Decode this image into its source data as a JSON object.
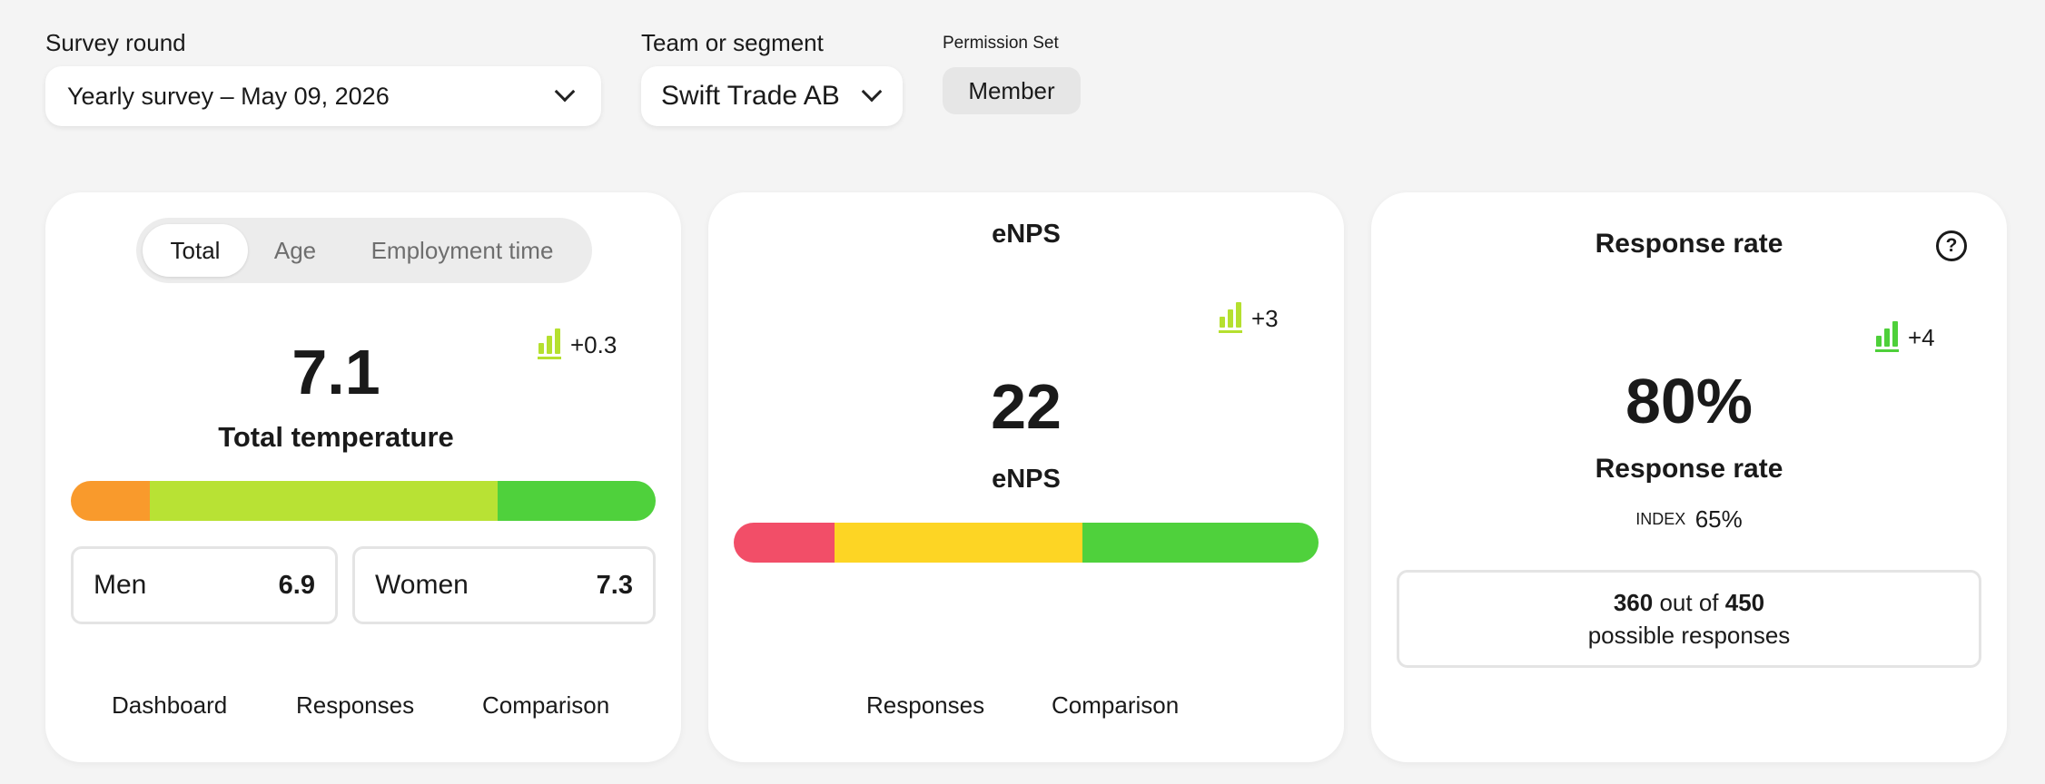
{
  "filters": {
    "survey_round_label": "Survey round",
    "survey_round_value": "Yearly survey – May 09, 2026",
    "team_label": "Team or segment",
    "team_value": "Swift Trade AB",
    "permission_label": "Permission Set",
    "permission_value": "Member"
  },
  "temperature_card": {
    "tabs": [
      {
        "label": "Total",
        "active": true
      },
      {
        "label": "Age",
        "active": false
      },
      {
        "label": "Employment time",
        "active": false
      }
    ],
    "trend": "+0.3",
    "value": "7.1",
    "title": "Total temperature",
    "scale_segments": [
      {
        "color": "#f99a2c",
        "fraction": 0.135
      },
      {
        "color": "#b8e234",
        "fraction": 0.595
      },
      {
        "color": "#4fd13c",
        "fraction": 0.27
      }
    ],
    "groups": [
      {
        "name": "Men",
        "value": "6.9"
      },
      {
        "name": "Women",
        "value": "7.3"
      }
    ],
    "links": [
      "Dashboard",
      "Responses",
      "Comparison"
    ]
  },
  "enps_card": {
    "header": "eNPS",
    "trend": "+3",
    "value": "22",
    "title": "eNPS",
    "scale_segments": [
      {
        "color": "#f24e68",
        "fraction": 0.172
      },
      {
        "color": "#fdd524",
        "fraction": 0.425
      },
      {
        "color": "#4fd13c",
        "fraction": 0.403
      }
    ],
    "links": [
      "Responses",
      "Comparison"
    ]
  },
  "response_card": {
    "header": "Response rate",
    "help_icon": "?",
    "trend": "+4",
    "value": "80%",
    "title": "Response rate",
    "index_label": "INDEX",
    "index_value": "65%",
    "responses_count": "360",
    "responses_mid": "out of",
    "responses_total": "450",
    "responses_suffix": "possible responses"
  }
}
